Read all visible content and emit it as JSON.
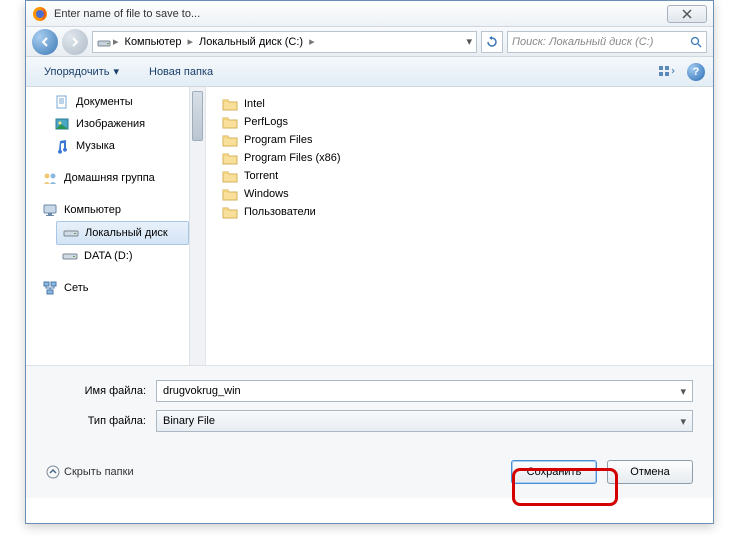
{
  "title": "Enter name of file to save to...",
  "nav": {
    "crumbs": [
      "Компьютер",
      "Локальный диск (C:)"
    ],
    "search_placeholder": "Поиск: Локальный диск (C:)"
  },
  "toolbar": {
    "organize": "Упорядочить",
    "new_folder": "Новая папка"
  },
  "sidebar": {
    "libs": [
      "Документы",
      "Изображения",
      "Музыка"
    ],
    "homegroup": "Домашняя группа",
    "computer": "Компьютер",
    "drives": [
      "Локальный диск",
      "DATA (D:)"
    ],
    "network": "Сеть"
  },
  "files": [
    "Intel",
    "PerfLogs",
    "Program Files",
    "Program Files (x86)",
    "Torrent",
    "Windows",
    "Пользователи"
  ],
  "form": {
    "name_label": "Имя файла:",
    "name_value": "drugvokrug_win",
    "type_label": "Тип файла:",
    "type_value": "Binary File"
  },
  "footer": {
    "hide": "Скрыть папки",
    "save": "Сохранить",
    "cancel": "Отмена"
  }
}
